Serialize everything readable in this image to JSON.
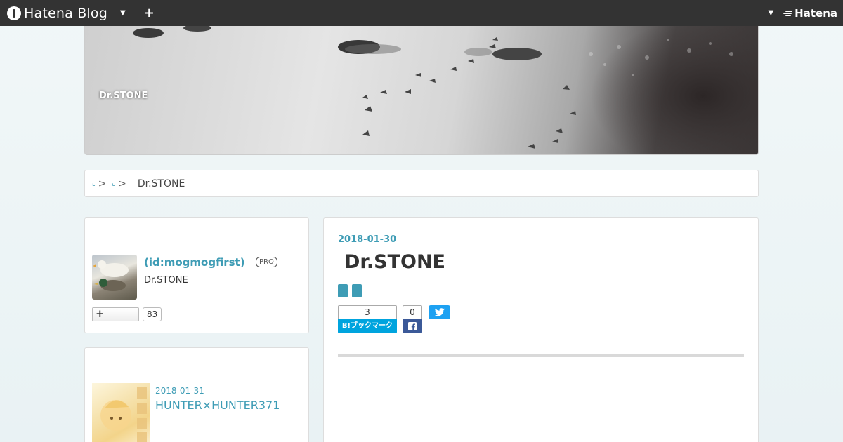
{
  "topbar": {
    "brand": "Hatena Blog",
    "caret_icon": "chevron-down-icon",
    "plus_icon": "plus-icon",
    "right_brand": "Hatena"
  },
  "header": {
    "blog_title": "Dr.STONE"
  },
  "breadcrumb": {
    "items": [
      "",
      ""
    ],
    "separator": ">",
    "current": "Dr.STONE"
  },
  "profile": {
    "id_text": " (id:mogmogfirst)",
    "badge": "PRO",
    "description": "Dr.STONE",
    "follow_label": "+",
    "follow_count": "83"
  },
  "recent": {
    "date": "2018-01-31",
    "title": "HUNTER×HUNTER371"
  },
  "article": {
    "date": "2018-01-30",
    "title": "Dr.STONE",
    "categories": [
      "",
      ""
    ],
    "hatena_bookmark": {
      "count": "3",
      "label": "B!ブックマーク"
    },
    "facebook": {
      "count": "0"
    }
  },
  "colors": {
    "accent": "#3e9cb5",
    "topbar": "#333333",
    "hatena_blue": "#00a4de",
    "facebook": "#3b5998",
    "twitter": "#1da1f2"
  }
}
